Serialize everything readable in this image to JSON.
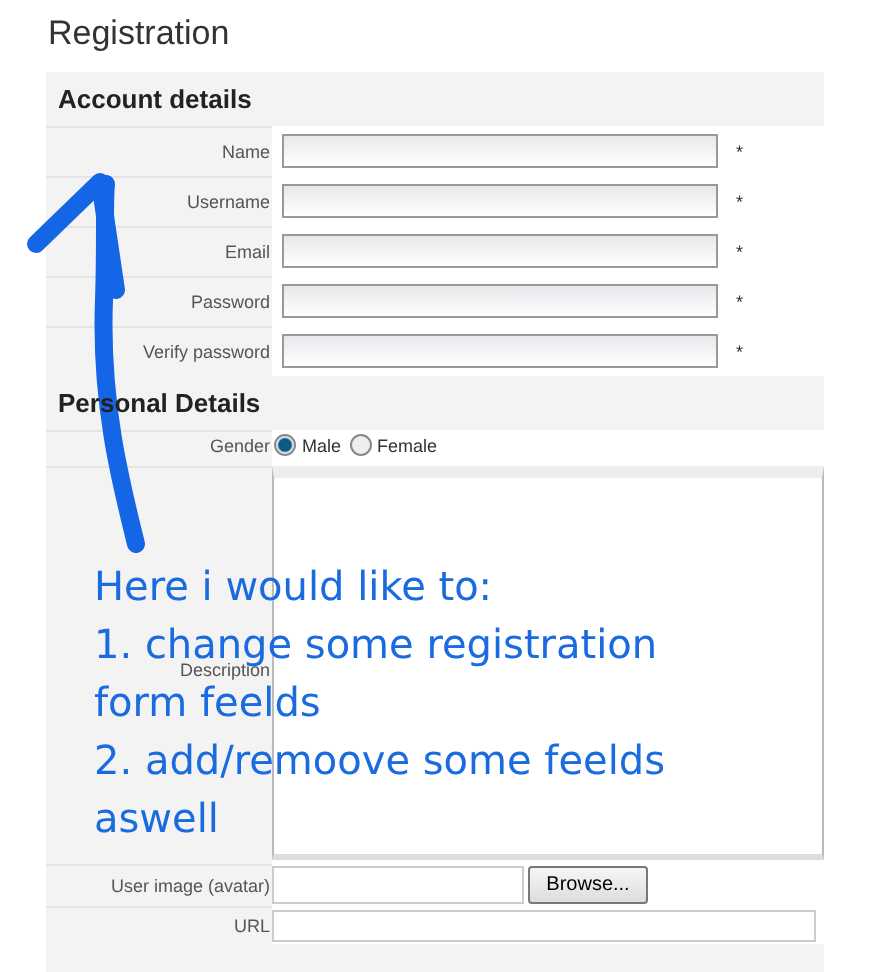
{
  "title": "Registration",
  "sections": [
    {
      "title": "Account details",
      "fields": [
        {
          "kind": "text",
          "label": "Name",
          "required_mark": "*"
        },
        {
          "kind": "text",
          "label": "Username",
          "required_mark": "*"
        },
        {
          "kind": "text",
          "label": "Email",
          "required_mark": "*"
        },
        {
          "kind": "text",
          "label": "Password",
          "required_mark": "*"
        },
        {
          "kind": "text",
          "label": "Verify password",
          "required_mark": "*"
        }
      ]
    },
    {
      "title": "Personal Details",
      "fields": [
        {
          "kind": "radio",
          "label": "Gender",
          "options": [
            {
              "label": "Male",
              "selected": true
            },
            {
              "label": "Female",
              "selected": false
            }
          ]
        },
        {
          "kind": "textarea",
          "label": "Description"
        },
        {
          "kind": "file",
          "label": "User image (avatar)",
          "button": "Browse..."
        },
        {
          "kind": "url",
          "label": "URL"
        }
      ]
    }
  ],
  "more_sections_below": true,
  "annotation": {
    "lines": [
      "Here i would like to:",
      "1. change some registration",
      "form feelds",
      "2. add/remoove some feelds",
      "aswell"
    ]
  }
}
